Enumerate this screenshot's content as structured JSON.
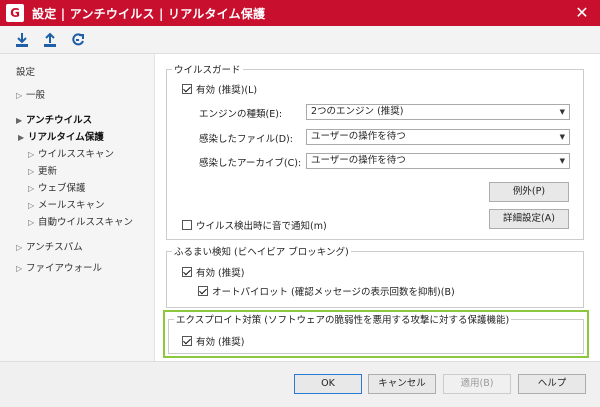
{
  "window": {
    "logo": "G",
    "title": "設定 | アンチウイルス | リアルタイム保護",
    "close_glyph": "✕"
  },
  "toolbar": {
    "buttons": [
      {
        "icon": "download-icon"
      },
      {
        "icon": "upload-icon"
      },
      {
        "icon": "restore-defaults-icon"
      }
    ]
  },
  "sidebar": {
    "items": [
      {
        "label": "設定",
        "arrow": ""
      },
      {
        "label": "一般",
        "arrow": "▷"
      },
      {
        "label": "アンチウイルス",
        "arrow": "▶"
      },
      {
        "label": "リアルタイム保護",
        "arrow": "▶"
      },
      {
        "label": "ウイルススキャン",
        "arrow": "▷"
      },
      {
        "label": "更新",
        "arrow": "▷"
      },
      {
        "label": "ウェブ保護",
        "arrow": "▷"
      },
      {
        "label": "メールスキャン",
        "arrow": "▷"
      },
      {
        "label": "自動ウイルススキャン",
        "arrow": "▷"
      },
      {
        "label": "アンチスパム",
        "arrow": "▷"
      },
      {
        "label": "ファイアウォール",
        "arrow": "▷"
      }
    ]
  },
  "virus_guard": {
    "legend": "ウイルスガード",
    "enabled_label": "有効 (推奨)(L)",
    "engine_label": "エンジンの種類(E):",
    "engine_value": "2つのエンジン (推奨)",
    "infected_file_label": "感染したファイル(D):",
    "infected_file_value": "ユーザーの操作を待つ",
    "infected_archive_label": "感染したアーカイブ(C):",
    "infected_archive_value": "ユーザーの操作を待つ",
    "exceptions_button": "例外(P)",
    "advanced_button": "詳細設定(A)",
    "sound_notify_label": "ウイルス検出時に音で通知(m)",
    "caret": "▼"
  },
  "behavior_blocking": {
    "legend": "ふるまい検知 (ビヘイビア ブロッキング)",
    "enabled_label": "有効 (推奨)",
    "autopilot_label": "オートパイロット (確認メッセージの表示回数を抑制)(B)"
  },
  "exploit_protection": {
    "legend": "エクスプロイト対策 (ソフトウェアの脆弱性を悪用する攻撃に対する保護機能)",
    "enabled_label": "有効 (推奨)"
  },
  "footer": {
    "ok": "OK",
    "cancel": "キャンセル",
    "apply": "適用(B)",
    "help": "ヘルプ"
  },
  "colors": {
    "title_bar": "#c8102e",
    "highlight": "#8dc63f",
    "toolbar_icon": "#1f5fa8"
  }
}
